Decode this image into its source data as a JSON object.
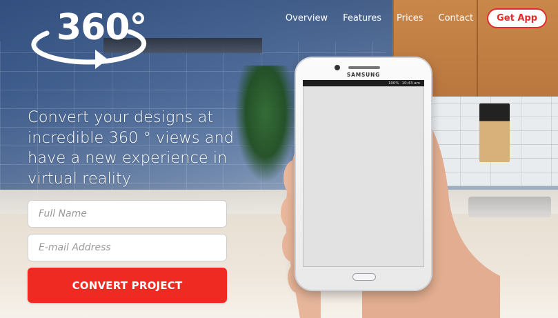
{
  "logo": {
    "text": "360°"
  },
  "nav": {
    "links": [
      "Overview",
      "Features",
      "Prices",
      "Contact"
    ],
    "cta_label": "Get App"
  },
  "hero": {
    "headline": "Convert your designs at incredible 360 ° views and have a new experience in virtual reality"
  },
  "form": {
    "name_placeholder": "Full Name",
    "email_placeholder": "E-mail Address",
    "submit_label": "CONVERT PROJECT"
  },
  "phone": {
    "brand": "SAMSUNG",
    "battery": "100%",
    "time": "10:43 am"
  },
  "colors": {
    "accent": "#ee2a22",
    "text_light": "#ffffff"
  }
}
